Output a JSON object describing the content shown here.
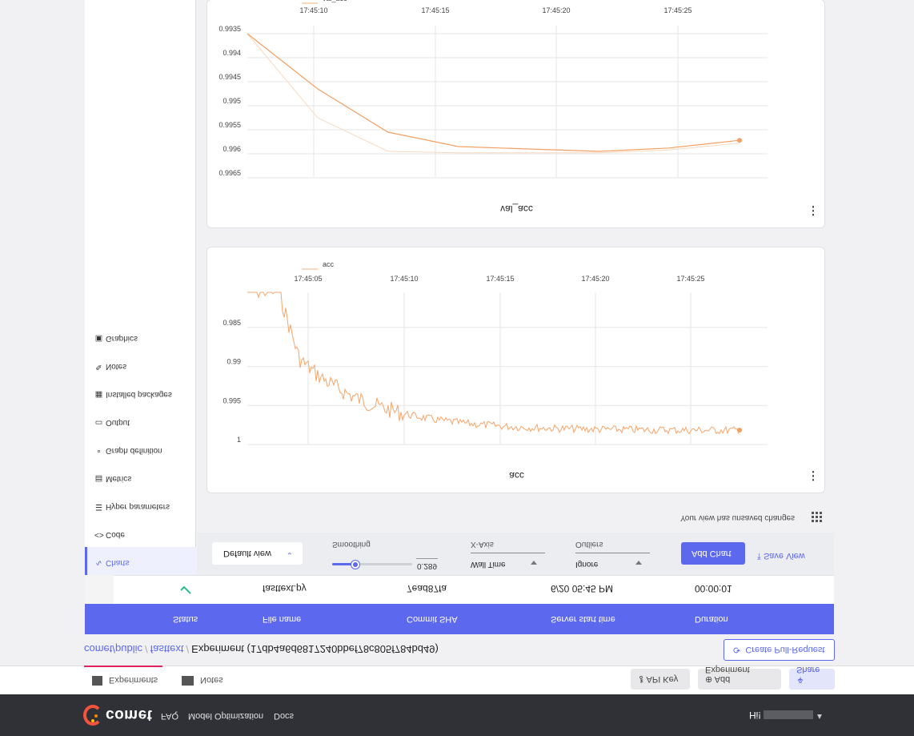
{
  "topnav": {
    "logo": "comet",
    "links": [
      "FAQ",
      "Model Optimization",
      "Docs"
    ],
    "greeting": "Hi!"
  },
  "tabs": {
    "experiments": "Experiments",
    "notes": "Notes"
  },
  "toolbar_buttons": {
    "api_key": "API Key",
    "add_experiment": "Add Experiment",
    "share": "Share"
  },
  "breadcrumb": {
    "workspace": "comet/public",
    "project": "fasttext",
    "current": "Experiment (17db4a6d6817240bbef78c805f784bd49)"
  },
  "create_pr": "Create Pull-Request",
  "table": {
    "headers": [
      "Status",
      "File name",
      "Commit SHA",
      "Server start time",
      "Duration"
    ],
    "row": {
      "file_name": "fasttext.py",
      "commit_sha": "7ead87fa",
      "start_time": "6/20 05:45 PM",
      "duration": "00:00:01"
    }
  },
  "sidebar": {
    "items": [
      {
        "icon": "chart-line-icon",
        "label": "Charts"
      },
      {
        "icon": "code-icon",
        "label": "Code"
      },
      {
        "icon": "list-icon",
        "label": "Hyper parameters"
      },
      {
        "icon": "table-icon",
        "label": "Metrics"
      },
      {
        "icon": "graph-icon",
        "label": "Graph definition"
      },
      {
        "icon": "monitor-icon",
        "label": "Output"
      },
      {
        "icon": "package-icon",
        "label": "Installed packages"
      },
      {
        "icon": "pencil-icon",
        "label": "Notes"
      },
      {
        "icon": "image-icon",
        "label": "Graphics"
      }
    ]
  },
  "chart_toolbar": {
    "view": "Default view",
    "smoothing_label": "Smoothing",
    "smoothing_value": "0.289",
    "smoothing_fraction": 0.289,
    "xaxis_label": "X-Axis",
    "xaxis_value": "Wall Time",
    "outliers_label": "Outliers",
    "outliers_value": "Ignore",
    "add_chart": "Add Chart",
    "save_view": "Save View",
    "unsaved": "Your view has unsaved changes"
  },
  "colors": {
    "accent": "#5c68ed",
    "series": "#f4a063",
    "raw": "#f8d9bf"
  },
  "chart_data": [
    {
      "type": "line",
      "title": "acc",
      "legend": [
        "acc"
      ],
      "x_ticks": [
        "17:45:05",
        "17:45:10",
        "17:45:15",
        "17:45:20",
        "17:45:25"
      ],
      "y_ticks": [
        "0.985",
        "0.99",
        "0.995",
        "1"
      ],
      "ylim": [
        0.9805,
        1.0
      ]
    },
    {
      "type": "line",
      "title": "val_acc",
      "legend": [
        "val_acc"
      ],
      "x_ticks": [
        "17:45:10",
        "17:45:15",
        "17:45:20",
        "17:45:25"
      ],
      "y_ticks": [
        "0.9935",
        "0.994",
        "0.9945",
        "0.995",
        "0.9955",
        "0.996",
        "0.9965"
      ],
      "ylim": [
        0.9935,
        0.9965
      ],
      "series": [
        {
          "name": "val_acc",
          "x": [
            0,
            1,
            2,
            3,
            4,
            5,
            6,
            7
          ],
          "y": [
            0.9935,
            0.99465,
            0.99555,
            0.99585,
            0.9959,
            0.99595,
            0.99588,
            0.99572
          ]
        }
      ]
    }
  ]
}
